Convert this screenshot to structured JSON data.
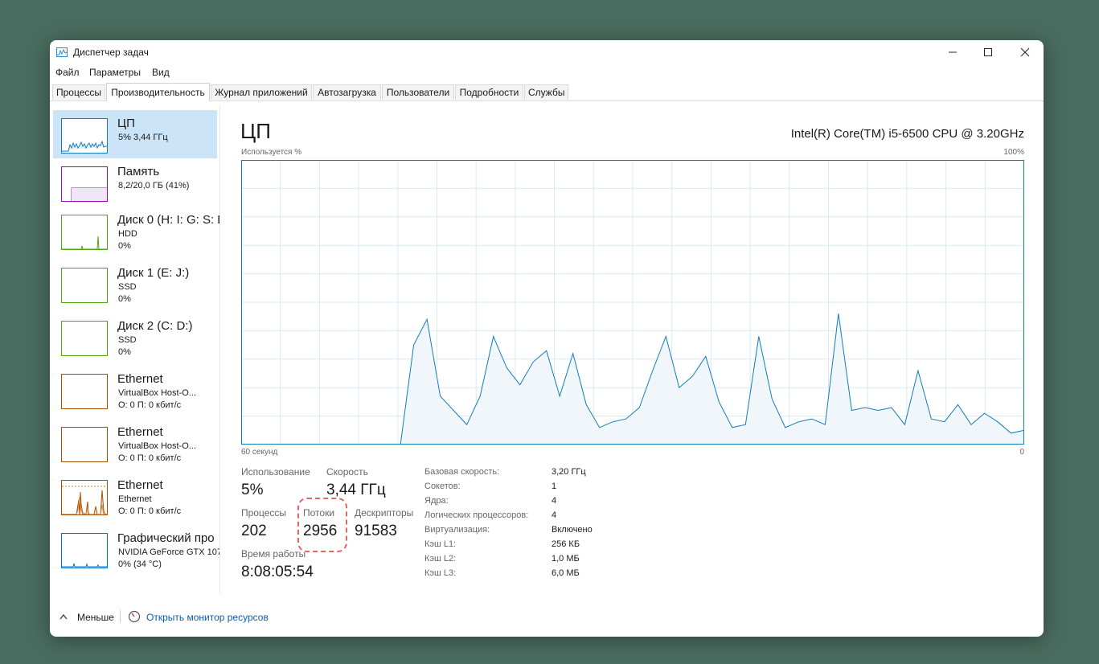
{
  "window": {
    "title": "Диспетчер задач"
  },
  "menu": [
    "Файл",
    "Параметры",
    "Вид"
  ],
  "tabs": [
    "Процессы",
    "Производительность",
    "Журнал приложений",
    "Автозагрузка",
    "Пользователи",
    "Подробности",
    "Службы"
  ],
  "active_tab": "Производительность",
  "sidebar": [
    {
      "name": "ЦП",
      "sub1": "5%  3,44 ГГц",
      "sub2": "",
      "sub3": ""
    },
    {
      "name": "Память",
      "sub1": "8,2/20,0 ГБ (41%)",
      "sub2": "",
      "sub3": ""
    },
    {
      "name": "Диск 0 (H: I: G: S: L",
      "sub1": "HDD",
      "sub2": "0%",
      "sub3": ""
    },
    {
      "name": "Диск 1 (E: J:)",
      "sub1": "SSD",
      "sub2": "0%",
      "sub3": ""
    },
    {
      "name": "Диск 2 (C: D:)",
      "sub1": "SSD",
      "sub2": "0%",
      "sub3": ""
    },
    {
      "name": "Ethernet",
      "sub1": "VirtualBox Host-O...",
      "sub2": "О: 0 П: 0 кбит/с",
      "sub3": ""
    },
    {
      "name": "Ethernet",
      "sub1": "VirtualBox Host-O...",
      "sub2": "О: 0 П: 0 кбит/с",
      "sub3": ""
    },
    {
      "name": "Ethernet",
      "sub1": "Ethernet",
      "sub2": "О: 0 П: 0 кбит/с",
      "sub3": ""
    },
    {
      "name": "Графический про",
      "sub1": "NVIDIA GeForce GTX 107",
      "sub2": "0% (34 °C)",
      "sub3": ""
    }
  ],
  "colors": {
    "cpu": "#117dbb",
    "memory": "#8b12ae",
    "disk": "#4da60c",
    "ethernet": "#a74f01",
    "gpu": "#0071c5",
    "selected": "#cce4f7",
    "highlight": "#e06666"
  },
  "main": {
    "title": "ЦП",
    "cpu_model": "Intel(R) Core(TM) i5-6500 CPU @ 3.20GHz",
    "graph_label_left": "Используется %",
    "graph_label_right": "100%",
    "graph_bottom_left": "60 секунд",
    "graph_bottom_right": "0"
  },
  "stats": {
    "usage_label": "Использование",
    "usage_value": "5%",
    "speed_label": "Скорость",
    "speed_value": "3,44 ГГц",
    "processes_label": "Процессы",
    "processes_value": "202",
    "threads_label": "Потоки",
    "threads_value": "2956",
    "handles_label": "Дескрипторы",
    "handles_value": "91583",
    "uptime_label": "Время работы",
    "uptime_value": "8:08:05:54"
  },
  "info": [
    {
      "label": "Базовая скорость:",
      "value": "3,20 ГГц"
    },
    {
      "label": "Сокетов:",
      "value": "1"
    },
    {
      "label": "Ядра:",
      "value": "4"
    },
    {
      "label": "Логических процессоров:",
      "value": "4"
    },
    {
      "label": "Виртуализация:",
      "value": "Включено"
    },
    {
      "label": "Кэш L1:",
      "value": "256 КБ"
    },
    {
      "label": "Кэш L2:",
      "value": "1,0 МБ"
    },
    {
      "label": "Кэш L3:",
      "value": "6,0 МБ"
    }
  ],
  "footer": {
    "less_label": "Меньше",
    "monitor_link": "Открыть монитор ресурсов"
  },
  "chart_data": {
    "type": "area",
    "xlabel": "60 секунд",
    "ylabel": "Используется %",
    "xlim": [
      60,
      0
    ],
    "ylim": [
      0,
      100
    ],
    "grid": true,
    "series": [
      {
        "values": [
          0,
          0,
          0,
          0,
          0,
          0,
          0,
          0,
          0,
          0,
          0,
          0,
          0,
          35,
          44,
          17,
          12,
          7,
          17,
          38,
          27,
          21,
          29,
          33,
          17,
          32,
          14,
          6,
          8,
          9,
          13,
          26,
          38,
          20,
          24,
          31,
          15,
          6,
          7,
          38,
          16,
          6,
          8,
          9,
          7,
          46,
          12,
          13,
          12,
          13,
          7,
          26,
          9,
          8,
          14,
          7,
          11,
          8,
          4,
          5
        ]
      }
    ]
  }
}
